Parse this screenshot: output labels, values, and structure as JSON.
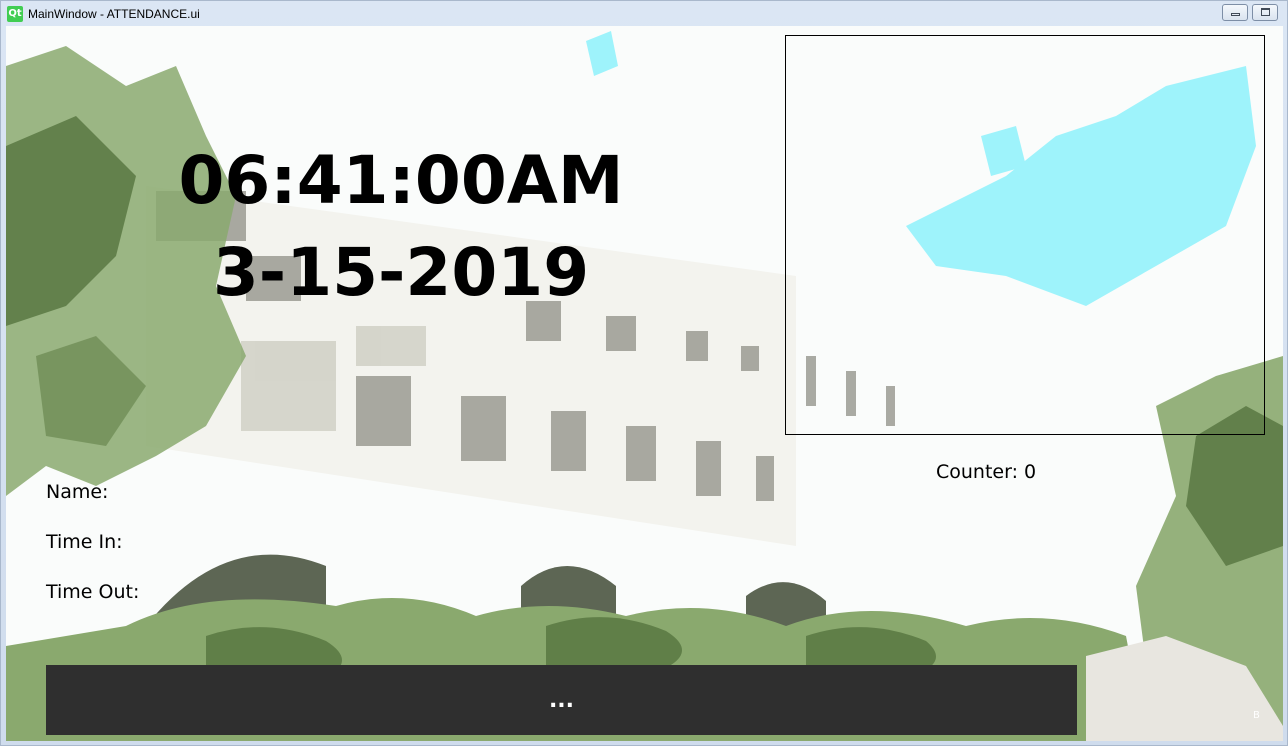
{
  "window": {
    "title": "MainWindow - ATTENDANCE.ui",
    "app_icon": "qt-logo-icon",
    "app_icon_text": "Qt",
    "controls": [
      "minimize-icon",
      "maximize-icon"
    ]
  },
  "clock": {
    "time": "06:41:00AM",
    "date": "3-15-2019"
  },
  "camera": {
    "counter_label": "Counter: 0"
  },
  "fields": {
    "name_label": "Name:",
    "time_in_label": "Time In:",
    "time_out_label": "Time Out:"
  },
  "action_button": {
    "label": "..."
  },
  "corner_text": "B",
  "colors": {
    "button_bg": "#2f2f2f",
    "foliage": "#8aa96e",
    "water": "#9ef3fb"
  }
}
